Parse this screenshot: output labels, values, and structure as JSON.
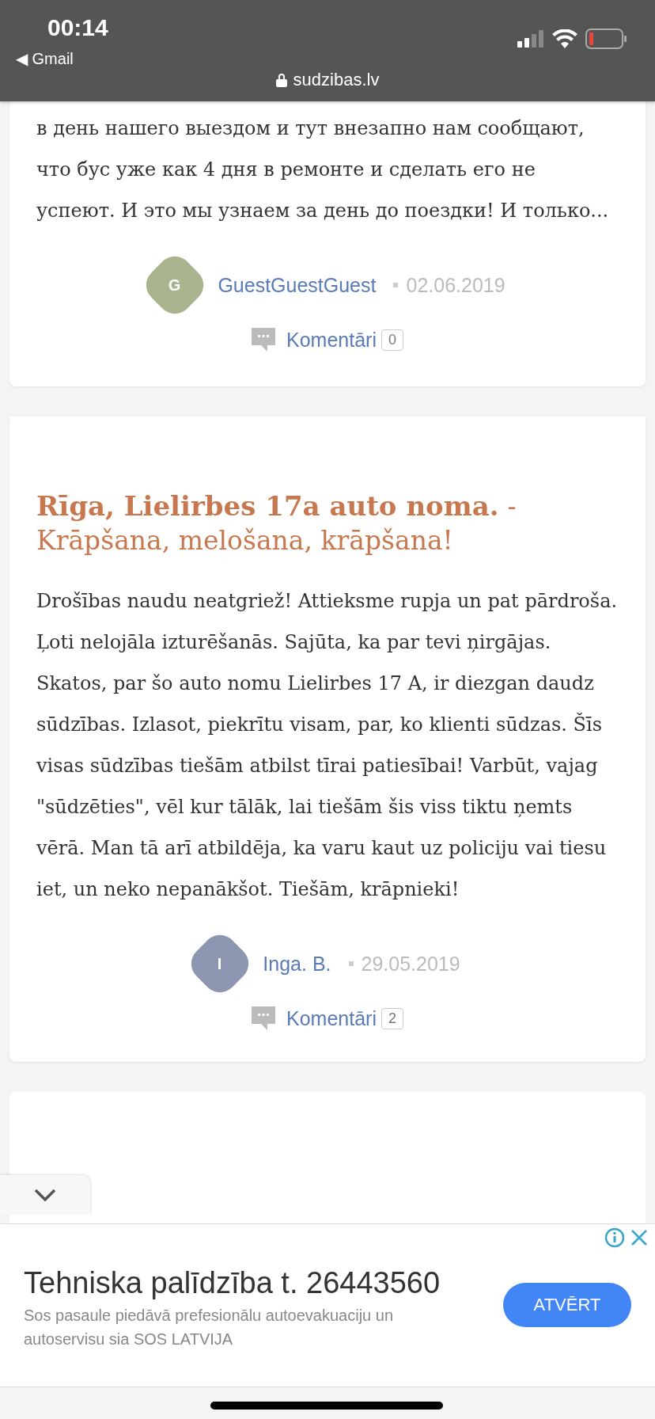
{
  "status_bar": {
    "time": "00:14",
    "back_app": "◀ Gmail"
  },
  "browser": {
    "url": "sudzibas.lv"
  },
  "posts": [
    {
      "text": "в день нашего выездом и тут внезапно нам сообщают, что бус уже как 4 дня в ремонте и сделать его не успеют. И это мы узнаем за день до поездки! И только...",
      "author": {
        "initial": "G",
        "name": "GuestGuestGuest",
        "color": "#a9b48f"
      },
      "date": "02.06.2019",
      "comments_label": "Komentāri",
      "comments_count": "0"
    },
    {
      "title": "Rīga, Lielirbes 17a auto noma.",
      "separator": "-",
      "subtitle": "Krāpšana, melošana, krāpšana!",
      "text": "Drošības naudu neatgriež! Attieksme rupja un pat pārdroša. Ļoti nelojāla izturēšanās. Sajūta, ka par tevi ņirgājas. Skatos, par šo auto nomu Lielirbes 17 A, ir diezgan daudz sūdzības. Izlasot, piekrītu visam, par, ko klienti sūdzas. Šīs visas sūdzības tiešām atbilst tīrai patiesībai! Varbūt, vajag \"sūdzēties\", vēl kur tālāk, lai tiešām šis viss tiktu ņemts vērā. Man tā arī atbildēja, ka varu kaut uz policiju vai tiesu iet, un neko nepanākšot. Tiešām, krāpnieki!",
      "author": {
        "initial": "I",
        "name": "Inga. B.",
        "color": "#8c96b0"
      },
      "date": "29.05.2019",
      "comments_label": "Komentāri",
      "comments_count": "2"
    }
  ],
  "ad": {
    "title": "Tehniska palīdzība t. 26443560",
    "description": "Sos pasaule piedāvā prefesionālu autoevakuaciju un autoservisu sia SOS LATVIJA",
    "button": "ATVĒRT"
  }
}
